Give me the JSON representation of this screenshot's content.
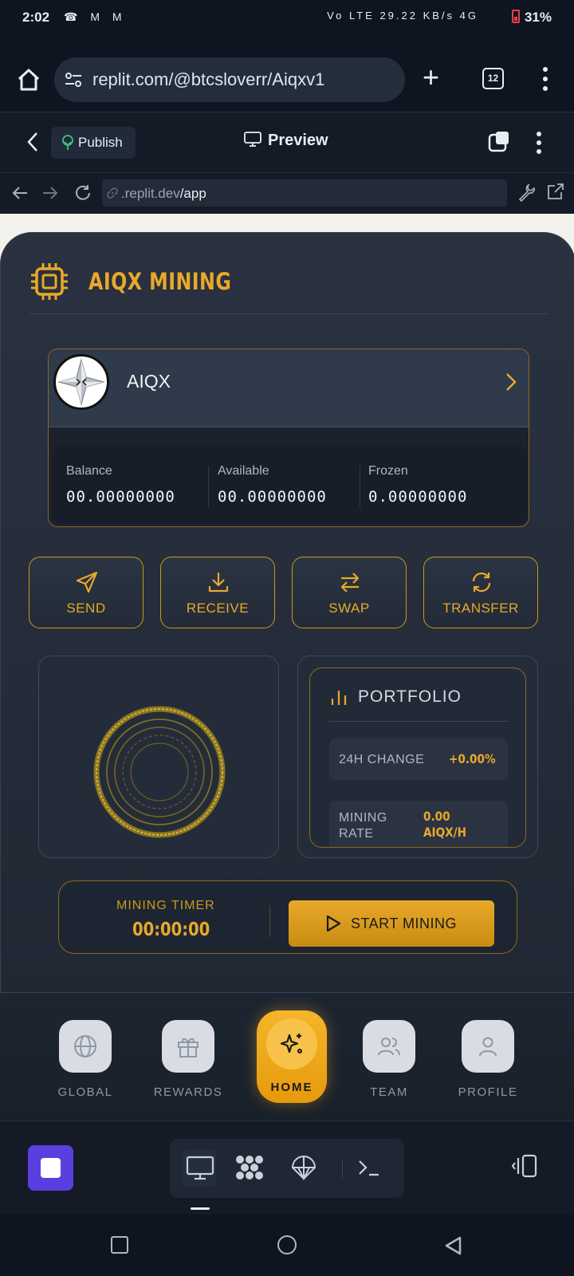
{
  "status_bar": {
    "time": "2:02",
    "left_icons": [
      "call-wifi-icon",
      "gmail-icon",
      "gmail-icon"
    ],
    "right_text": "Vo LTE 29.22 KB/s 4G",
    "battery_pct": "31%"
  },
  "browser": {
    "url": "replit.com/@btcsloverr/Aiqxv1",
    "tab_count": "12"
  },
  "replit_header": {
    "publish_label": "Publish",
    "preview_label": "Preview"
  },
  "webview": {
    "url_domain": ".replit.dev",
    "url_path": "/app"
  },
  "app": {
    "brand": "AIQX MINING",
    "token": {
      "name": "AIQX",
      "stats": [
        {
          "label": "Balance",
          "value": "00.00000000"
        },
        {
          "label": "Available",
          "value": "00.00000000"
        },
        {
          "label": "Frozen",
          "value": "0.00000000"
        }
      ]
    },
    "actions": [
      {
        "label": "SEND",
        "icon": "send-icon"
      },
      {
        "label": "RECEIVE",
        "icon": "download-icon"
      },
      {
        "label": "SWAP",
        "icon": "swap-icon"
      },
      {
        "label": "TRANSFER",
        "icon": "refresh-icon"
      }
    ],
    "portfolio": {
      "title": "PORTFOLIO",
      "rows": [
        {
          "label": "24H CHANGE",
          "value": "+0.00%"
        },
        {
          "label": "MINING RATE",
          "label_line1": "MINING",
          "label_line2": "RATE",
          "value_line1": "0.00",
          "value_line2": "AIQX/H"
        }
      ]
    },
    "timer": {
      "label": "MINING TIMER",
      "value": "00:00:00",
      "start_label": "START MINING"
    },
    "bottom_nav": [
      {
        "label": "GLOBAL",
        "icon": "globe-icon"
      },
      {
        "label": "REWARDS",
        "icon": "gift-icon"
      },
      {
        "label": "HOME",
        "icon": "sparkles-icon",
        "active": true
      },
      {
        "label": "TEAM",
        "icon": "users-icon"
      },
      {
        "label": "PROFILE",
        "icon": "user-icon"
      }
    ]
  },
  "colors": {
    "accent": "#e8a929",
    "card_bg": "#262d3a",
    "stop_button": "#5a3fe0"
  }
}
